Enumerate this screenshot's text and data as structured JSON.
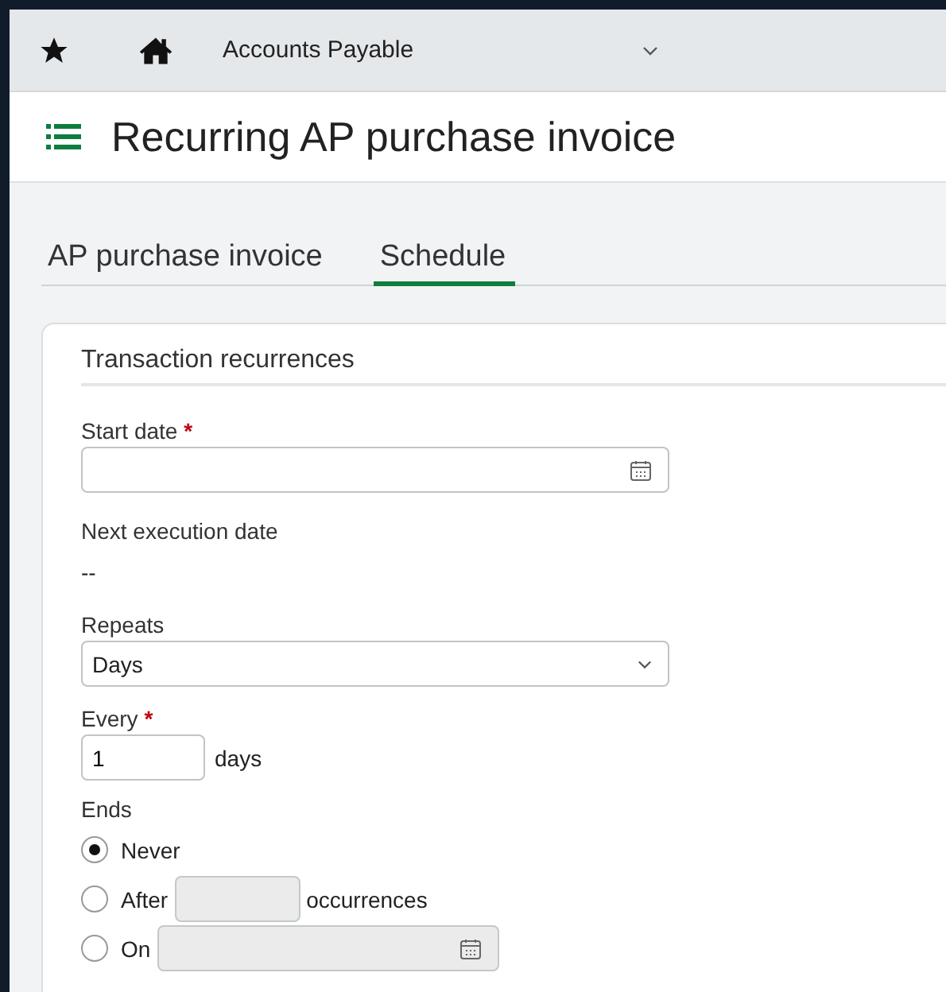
{
  "nav": {
    "module": "Accounts Payable"
  },
  "page_title": "Recurring AP purchase invoice",
  "tabs": [
    {
      "label": "AP purchase invoice",
      "selected": false
    },
    {
      "label": "Schedule",
      "selected": true
    }
  ],
  "section": {
    "title": "Transaction recurrences",
    "start_date": {
      "label": "Start date",
      "required_mark": "*"
    },
    "next_execution": {
      "label": "Next execution date",
      "value": "--"
    },
    "repeats": {
      "label": "Repeats",
      "value": "Days"
    },
    "every": {
      "label": "Every",
      "required_mark": "*",
      "value": "1",
      "unit": "days"
    },
    "ends": {
      "label": "Ends",
      "options": [
        {
          "kind": "plain",
          "label": "Never",
          "selected": true
        },
        {
          "kind": "count",
          "label": "After",
          "suffix": "occurrences",
          "selected": false,
          "disabled": true
        },
        {
          "kind": "date",
          "label": "On",
          "selected": false,
          "disabled": true
        }
      ]
    }
  }
}
